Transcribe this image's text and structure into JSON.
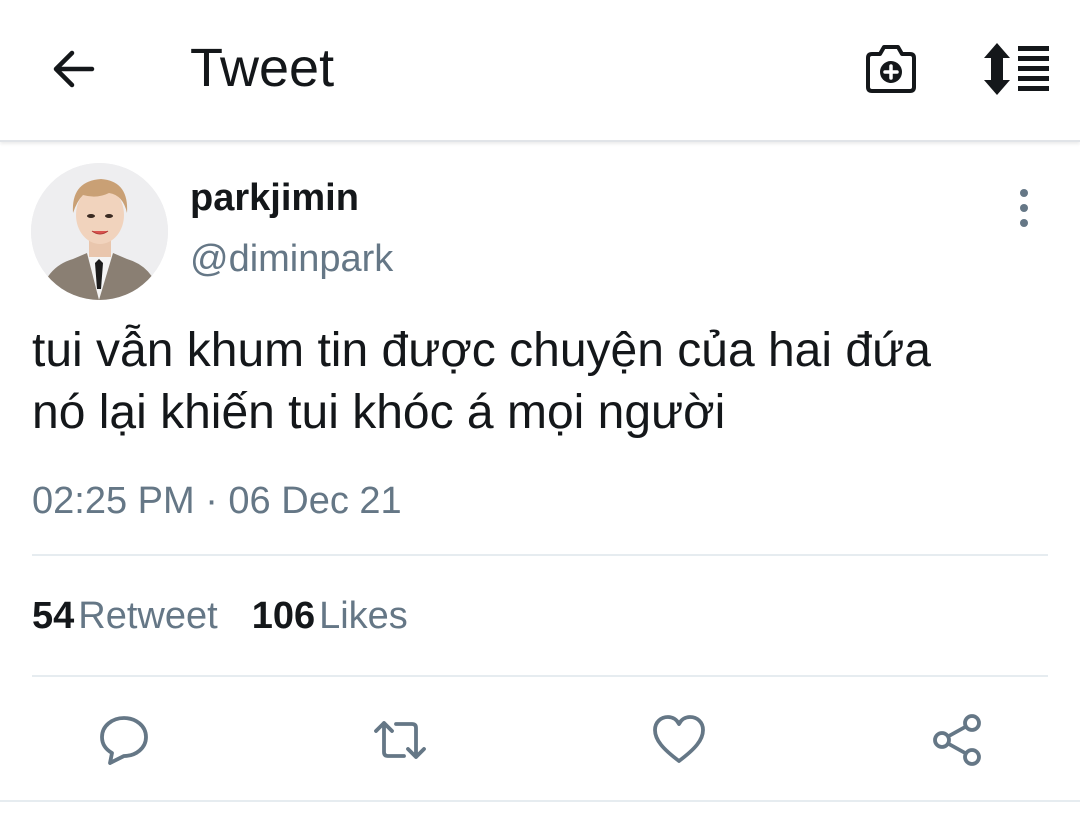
{
  "header": {
    "title": "Tweet",
    "back_icon": "arrow-left-icon",
    "camera_icon": "camera-plus-icon",
    "sort_icon": "sort-list-icon"
  },
  "tweet": {
    "display_name": "parkjimin",
    "handle": "@diminpark",
    "text_line_1": "tui vẫn khum tin được chuyện của hai đứa",
    "text_line_2": "nó lại khiến tui khóc á mọi người",
    "timestamp": "02:25 PM · 06 Dec 21",
    "more_icon": "more-vertical-icon"
  },
  "stats": {
    "retweets_count": "54",
    "retweets_label": "Retweet",
    "likes_count": "106",
    "likes_label": "Likes"
  },
  "actions": {
    "reply_icon": "reply-icon",
    "retweet_icon": "retweet-icon",
    "like_icon": "heart-icon",
    "share_icon": "share-icon"
  },
  "colors": {
    "text": "#14171a",
    "secondary": "#657786",
    "divider": "#e6ecf0"
  }
}
